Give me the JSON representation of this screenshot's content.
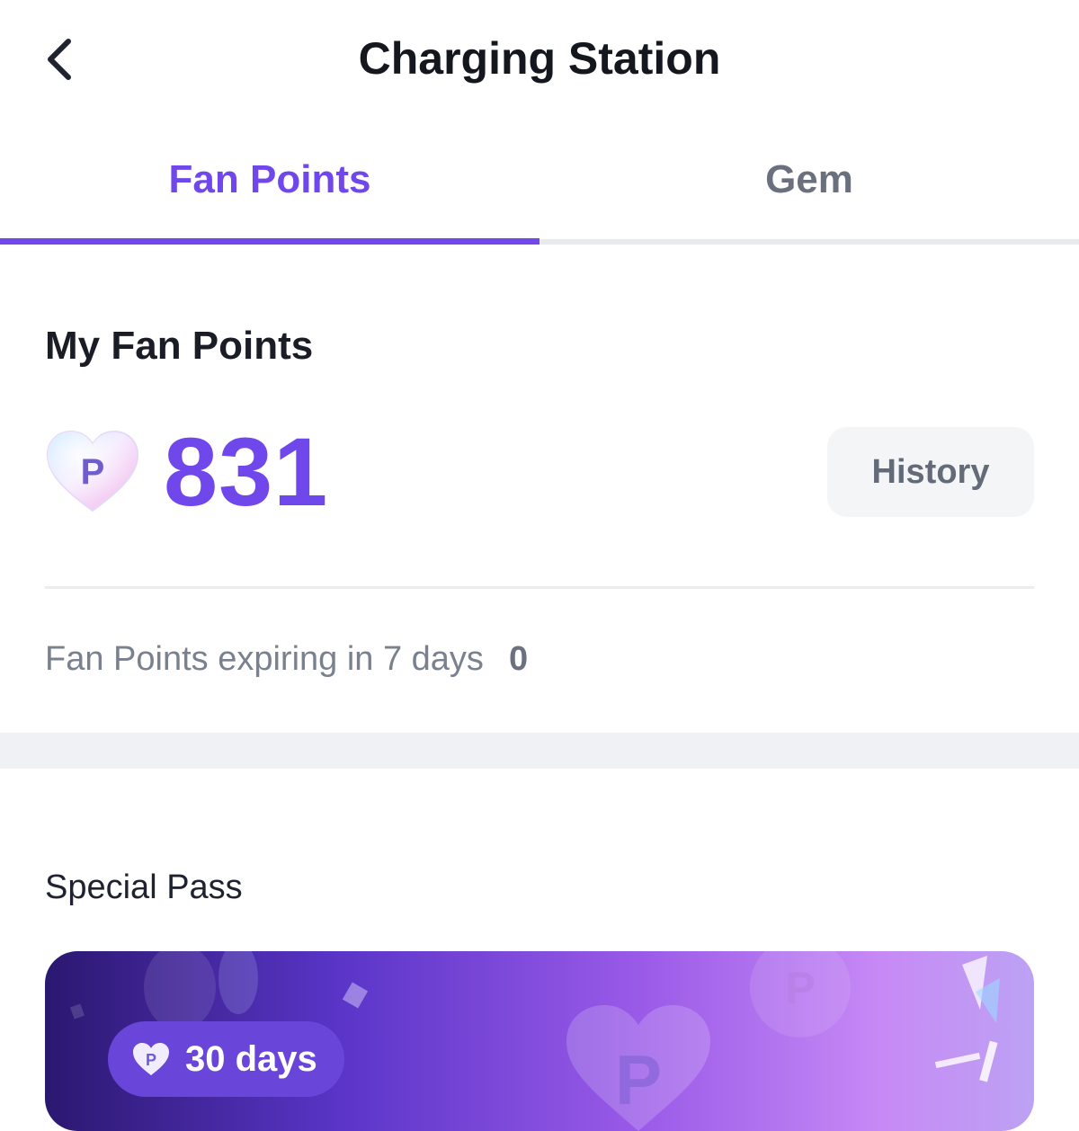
{
  "header": {
    "title": "Charging Station",
    "back_icon": "chevron-left-icon"
  },
  "tabs": [
    {
      "label": "Fan Points",
      "active": true
    },
    {
      "label": "Gem",
      "active": false
    }
  ],
  "fan_points": {
    "section_title": "My Fan Points",
    "icon": "fan-point-heart-icon",
    "icon_letter": "P",
    "balance": "831",
    "history_label": "History",
    "expiring_label": "Fan Points expiring in 7 days",
    "expiring_value": "0"
  },
  "special_pass": {
    "section_title": "Special Pass",
    "duration_label": "30 days"
  },
  "colors": {
    "accent": "#7047eb",
    "inactive_tab": "#6a707e",
    "muted_text": "#79808e"
  }
}
